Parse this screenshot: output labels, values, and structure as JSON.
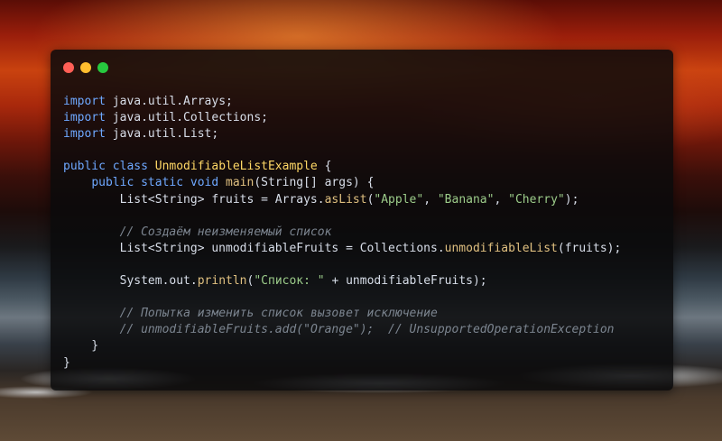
{
  "window_controls": {
    "close_color": "#ff5f56",
    "minimize_color": "#ffbd2e",
    "maximize_color": "#27c93f"
  },
  "code_lines": [
    [
      [
        "kw",
        "import"
      ],
      [
        "pl",
        " java.util.Arrays;"
      ]
    ],
    [
      [
        "kw",
        "import"
      ],
      [
        "pl",
        " java.util.Collections;"
      ]
    ],
    [
      [
        "kw",
        "import"
      ],
      [
        "pl",
        " java.util.List;"
      ]
    ],
    [],
    [
      [
        "kw",
        "public class"
      ],
      [
        "pl",
        " "
      ],
      [
        "cl",
        "UnmodifiableListExample"
      ],
      [
        "pl",
        " {"
      ]
    ],
    [
      [
        "pl",
        "    "
      ],
      [
        "kw",
        "public static void"
      ],
      [
        "pl",
        " "
      ],
      [
        "fn",
        "main"
      ],
      [
        "pl",
        "(String[] args) {"
      ]
    ],
    [
      [
        "pl",
        "        List<String> fruits = Arrays."
      ],
      [
        "fn",
        "asList"
      ],
      [
        "pl",
        "("
      ],
      [
        "st",
        "\"Apple\""
      ],
      [
        "pl",
        ", "
      ],
      [
        "st",
        "\"Banana\""
      ],
      [
        "pl",
        ", "
      ],
      [
        "st",
        "\"Cherry\""
      ],
      [
        "pl",
        ");"
      ]
    ],
    [],
    [
      [
        "pl",
        "        "
      ],
      [
        "cm",
        "// Создаём неизменяемый список"
      ]
    ],
    [
      [
        "pl",
        "        List<String> unmodifiableFruits = Collections."
      ],
      [
        "fn",
        "unmodifiableList"
      ],
      [
        "pl",
        "(fruits);"
      ]
    ],
    [],
    [
      [
        "pl",
        "        System.out."
      ],
      [
        "fn",
        "println"
      ],
      [
        "pl",
        "("
      ],
      [
        "st",
        "\"Список: \""
      ],
      [
        "pl",
        " + unmodifiableFruits);"
      ]
    ],
    [],
    [
      [
        "pl",
        "        "
      ],
      [
        "cm",
        "// Попытка изменить список вызовет исключение"
      ]
    ],
    [
      [
        "pl",
        "        "
      ],
      [
        "cm",
        "// unmodifiableFruits.add(\"Orange\");  // UnsupportedOperationException"
      ]
    ],
    [
      [
        "pl",
        "    }"
      ]
    ],
    [
      [
        "pl",
        "}"
      ]
    ]
  ]
}
